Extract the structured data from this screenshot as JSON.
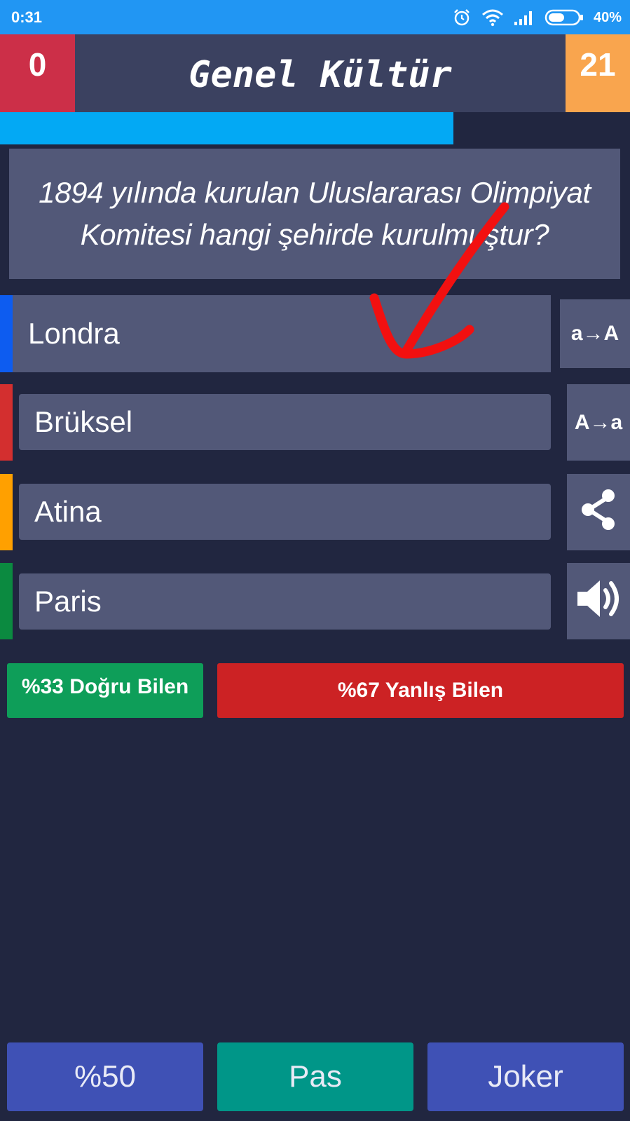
{
  "status_bar": {
    "time": "0:31",
    "battery_percent": "40%",
    "icons": [
      "alarm-icon",
      "wifi-icon",
      "signal-icon",
      "battery-icon"
    ]
  },
  "header": {
    "score_left": "0",
    "title": "Genel Kültür",
    "score_right": "21"
  },
  "progress": {
    "fraction": 0.72
  },
  "question": {
    "text": "1894 yılında kurulan Uluslararası Olimpiyat Komitesi hangi şehirde kurulmuştur?"
  },
  "answers": [
    {
      "label": "Londra",
      "color": "#0D5CF0"
    },
    {
      "label": "Brüksel",
      "color": "#D32F2F"
    },
    {
      "label": "Atina",
      "color": "#FFA000"
    },
    {
      "label": "Paris",
      "color": "#0B8A40"
    }
  ],
  "side_tools": {
    "increase_font": "a→A",
    "decrease_font": "A→a",
    "share_icon": "share-icon",
    "sound_icon": "speaker-icon"
  },
  "stats": {
    "correct": "%33 Doğru Bilen",
    "wrong": "%67 Yanlış Bilen"
  },
  "bottom_buttons": {
    "fifty": "%50",
    "pass": "Pas",
    "joker": "Joker"
  },
  "colors": {
    "background": "#212640",
    "panel": "#525878",
    "status_bar": "#2196F3",
    "score_left": "#CC2F48",
    "score_right": "#F9A54E",
    "progress": "#03A9F4",
    "correct": "#0E9E59",
    "wrong": "#CC2224",
    "pass_button": "#009688",
    "joker_button": "#3F51B5"
  }
}
